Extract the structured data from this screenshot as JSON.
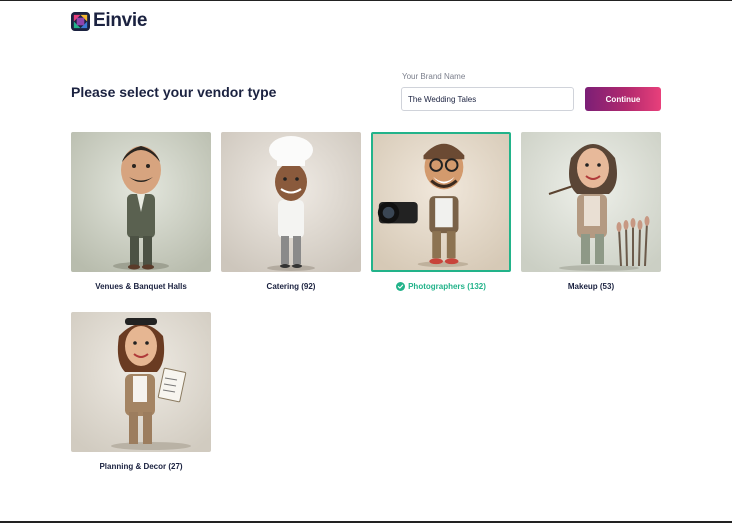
{
  "app": {
    "logo_text": "Einvie",
    "logo_icon": "einvie-logo-mark"
  },
  "page": {
    "title": "Please select your vendor type"
  },
  "brand": {
    "label": "Your Brand Name",
    "value": "The Wedding Tales",
    "continue_label": "Continue"
  },
  "vendors": [
    {
      "label": "Venues & Banquet Halls",
      "selected": false,
      "image": "caricature-man-in-suit"
    },
    {
      "label": "Catering (92)",
      "selected": false,
      "image": "caricature-chef"
    },
    {
      "label": "Photographers (132)",
      "selected": true,
      "image": "caricature-photographer-with-camera"
    },
    {
      "label": "Makeup (53)",
      "selected": false,
      "image": "caricature-makeup-artist-with-brushes"
    },
    {
      "label": "Planning & Decor (27)",
      "selected": false,
      "image": "caricature-planner-with-clipboard"
    }
  ],
  "colors": {
    "accent_selected": "#22b38a",
    "button_gradient_start": "#7b1f76",
    "button_gradient_end": "#e8407b",
    "title_text": "#1b2240"
  }
}
